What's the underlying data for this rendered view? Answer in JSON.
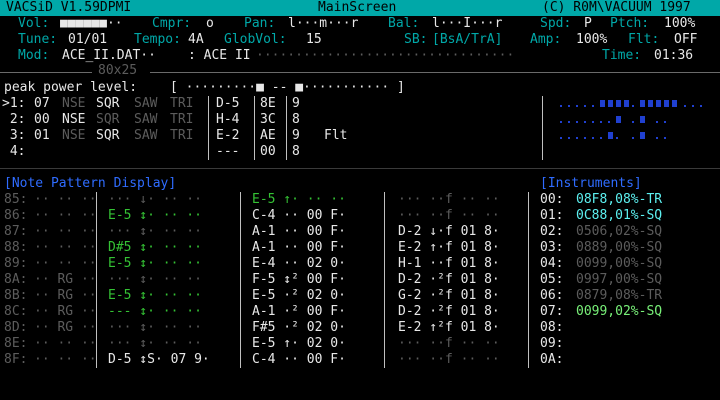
{
  "titlebar": {
    "app": "VACSiD V1.59DPMI",
    "screen": "MainScreen",
    "copyright": "(C) R0M\\VACUUM 1997"
  },
  "status": {
    "vol_label": "Vol:",
    "vol_value": "■■■■■■··",
    "cmpr_label": "Cmpr:",
    "cmpr_value": "o",
    "pan_label": "Pan:",
    "pan_value": "l···m···r",
    "bal_label": "Bal:",
    "bal_value": "l···I···r",
    "spd_label": "Spd:",
    "spd_value": "P",
    "ptch_label": "Ptch:",
    "ptch_value": "100%",
    "tune_label": "Tune:",
    "tune_value": "01/01",
    "tempo_label": "Tempo:",
    "tempo_value": "4A",
    "globvol_label": "GlobVol:",
    "globvol_value": "15",
    "sb_label": "SB:",
    "sb_value": "[BsA/TrA]",
    "amp_label": "Amp:",
    "amp_value": "100%",
    "flt_label": "Flt:",
    "flt_value": "OFF",
    "mod_label": "Mod:",
    "mod_value": "ACE_II.DAT··",
    "mod_name": ": ACE II",
    "dots": "·································",
    "time_label": "Time:",
    "time_value": "01:36",
    "resolution": "80x25"
  },
  "peak": {
    "label": "peak power level:",
    "value": "[ ·········■ -- ■··········· ]"
  },
  "voices": [
    {
      "idx": ">1:",
      "num": "07",
      "w": [
        "NSE",
        "SQR",
        "SAW",
        "TRI"
      ],
      "note": "D-5",
      "a": "8E",
      "b": "9",
      "flt": ""
    },
    {
      "idx": " 2:",
      "num": "00",
      "w": [
        "NSE",
        "SQR",
        "SAW",
        "TRI"
      ],
      "note": "H-4",
      "a": "3C",
      "b": "8",
      "flt": ""
    },
    {
      "idx": " 3:",
      "num": "01",
      "w": [
        "NSE",
        "SQR",
        "SAW",
        "TRI"
      ],
      "note": "E-2",
      "a": "AE",
      "b": "9",
      "flt": "Flt"
    },
    {
      "idx": " 4:",
      "num": "",
      "w": [
        "",
        "",
        "",
        ""
      ],
      "note": "---",
      "a": "00",
      "b": "8",
      "flt": ""
    }
  ],
  "pattern": {
    "header": "[Note Pattern Display]",
    "rows": [
      {
        "n": "85:",
        "c1": "·· ·· ··",
        "c2": "··· ↓· ·· ··",
        "c3": "E-5 ↑· ·· ··",
        "c4": "··· ··f ·· ··"
      },
      {
        "n": "86:",
        "c1": "·· ·· ··",
        "c2": "E-5 ↕· ·· ··",
        "c3": "C-4 ·· 00 F·",
        "c4": "··· ··f ·· ··"
      },
      {
        "n": "87:",
        "c1": "·· ·· ··",
        "c2": "··· ↕· ·· ··",
        "c3": "A-1 ·· 00 F·",
        "c4": "D-2 ↓·f 01 8·"
      },
      {
        "n": "88:",
        "c1": "·· ·· ··",
        "c2": "D#5 ↕· ·· ··",
        "c3": "A-1 ·· 00 F·",
        "c4": "E-2 ↑·f 01 8·"
      },
      {
        "n": "89:",
        "c1": "·· ·· ··",
        "c2": "E-5 ↕· ·· ··",
        "c3": "E-4 ·· 02 0·",
        "c4": "H-1 ··f 01 8·"
      },
      {
        "n": "8A:",
        "c1": "·· RG ··",
        "c2": "··· ↕· ·· ··",
        "c3": "F-5 ↕² 00 F·",
        "c4": "D-2 ·²f 01 8·"
      },
      {
        "n": "8B:",
        "c1": "·· RG ··",
        "c2": "E-5 ↕· ·· ··",
        "c3": "E-5 ·² 02 0·",
        "c4": "G-2 ·²f 01 8·"
      },
      {
        "n": "8C:",
        "c1": "·· RG ··",
        "c2": "--- ↕· ·· ··",
        "c3": "A-1 ·² 00 F·",
        "c4": "D-2 ·²f 01 8·"
      },
      {
        "n": "8D:",
        "c1": "·· RG ··",
        "c2": "··· ↕· ·· ··",
        "c3": "F#5 ·² 02 0·",
        "c4": "E-2 ↑²f 01 8·"
      },
      {
        "n": "8E:",
        "c1": "·· ·· ··",
        "c2": "··· ↕· ·· ··",
        "c3": "E-5 ↑· 02 0·",
        "c4": "··· ··f ·· ··"
      },
      {
        "n": "8F:",
        "c1": "·· ·· ··",
        "c2": "D-5 ↕S· 07 9·",
        "c3": "C-4 ·· 00 F·",
        "c4": "··· ··f ·· ··"
      }
    ]
  },
  "instruments": {
    "header": "[Instruments]",
    "rows": [
      {
        "n": "00:",
        "v": "08F8,08%-TR"
      },
      {
        "n": "01:",
        "v": "0C88,01%-SQ"
      },
      {
        "n": "02:",
        "v": "0506,02%-SQ"
      },
      {
        "n": "03:",
        "v": "0889,00%-SQ"
      },
      {
        "n": "04:",
        "v": "0099,00%-SQ"
      },
      {
        "n": "05:",
        "v": "0997,00%-SQ"
      },
      {
        "n": "06:",
        "v": "0879,08%-TR"
      },
      {
        "n": "07:",
        "v": "0099,02%-SQ"
      },
      {
        "n": "08:",
        "v": ""
      },
      {
        "n": "09:",
        "v": ""
      },
      {
        "n": "0A:",
        "v": ""
      }
    ]
  }
}
